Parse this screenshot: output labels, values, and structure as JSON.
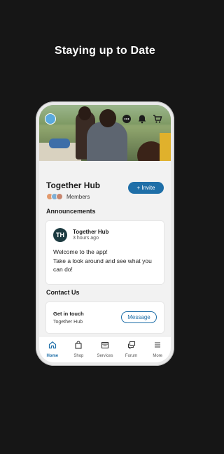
{
  "headline": "Staying up to Date",
  "hub": {
    "title": "Together Hub",
    "members_label": "Members",
    "invite_label": "+ Invite"
  },
  "announcements": {
    "section_title": "Announcements",
    "post": {
      "avatar_initials": "TH",
      "author": "Together Hub",
      "time": "3 hours ago",
      "line1": "Welcome to the app!",
      "line2": "Take a look around and see what you can do!"
    }
  },
  "contact": {
    "section_title": "Contact Us",
    "label": "Get in touch",
    "sub": "Together Hub",
    "message_label": "Message"
  },
  "tabs": [
    {
      "label": "Home",
      "icon": "home-icon",
      "active": true
    },
    {
      "label": "Shop",
      "icon": "shopping-bag-icon",
      "active": false
    },
    {
      "label": "Services",
      "icon": "calendar-icon",
      "active": false
    },
    {
      "label": "Forum",
      "icon": "chat-icon",
      "active": false
    },
    {
      "label": "More",
      "icon": "menu-icon",
      "active": false
    }
  ],
  "colors": {
    "accent": "#1f6fa8",
    "background": "#161616"
  }
}
